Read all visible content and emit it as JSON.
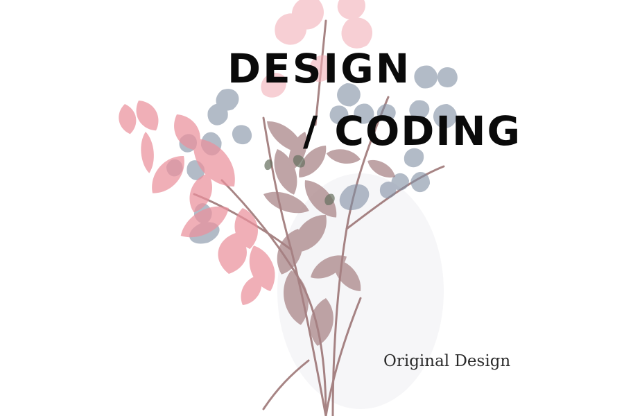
{
  "title": {
    "line1": "DESIGN",
    "line2": "/ CODING"
  },
  "subtitle": "Original Design",
  "colors": {
    "background": "#ffffff",
    "text": "#0a0a0a",
    "leaf_pink": "#e8818f",
    "leaf_blue_gray": "#6f7f96",
    "leaf_mauve": "#9a6f73",
    "stem": "#8a5b5b"
  }
}
